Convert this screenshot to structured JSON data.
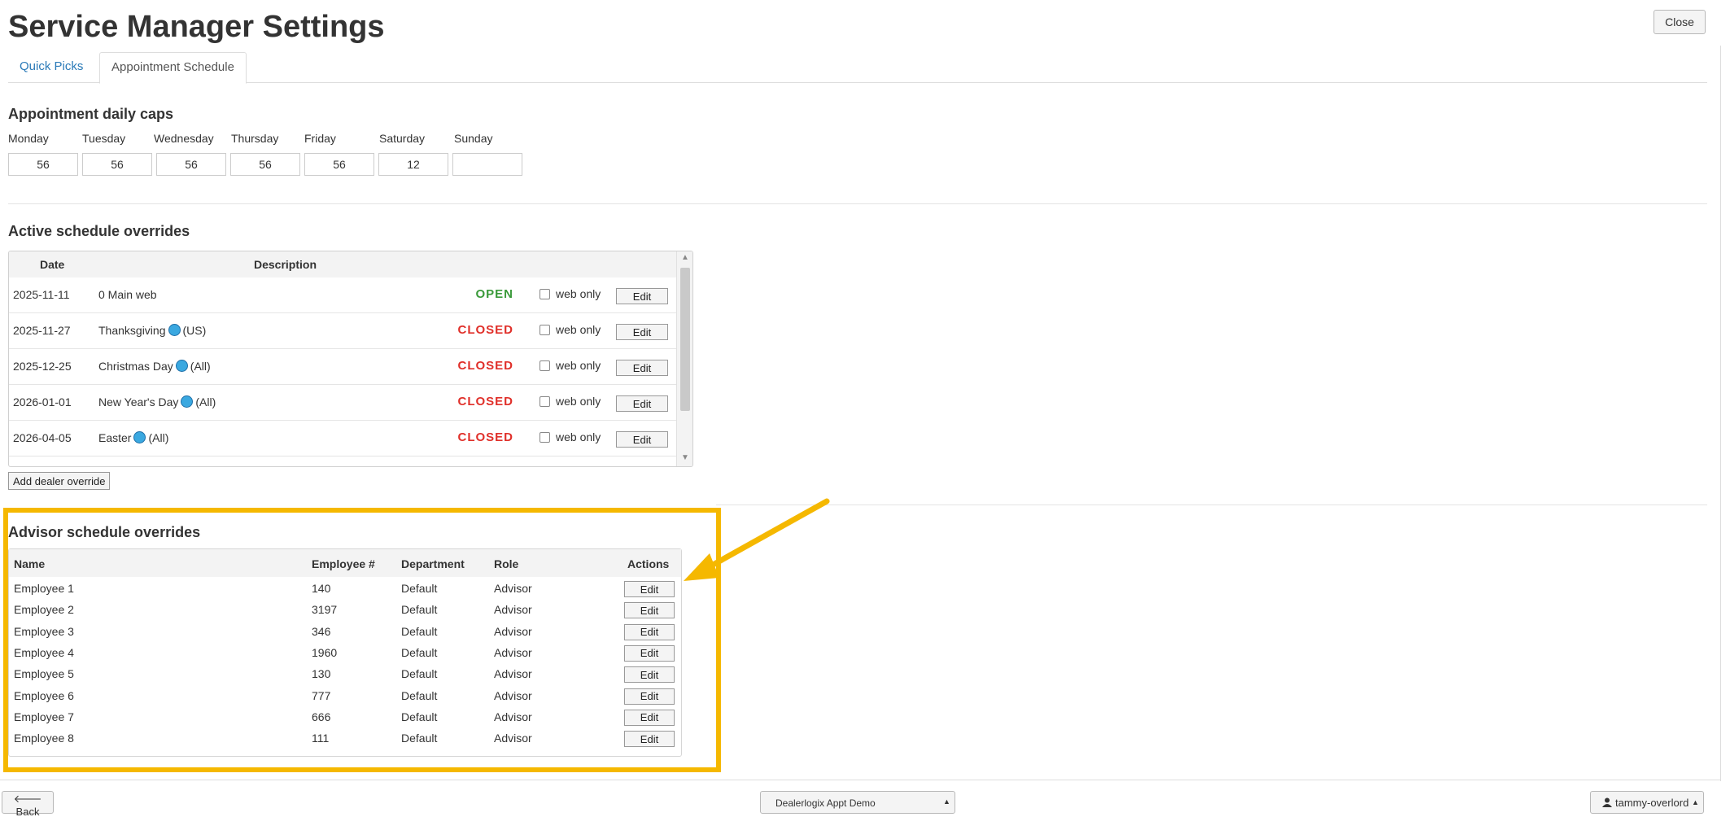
{
  "header": {
    "title": "Service Manager Settings",
    "close_label": "Close"
  },
  "tabs": [
    {
      "label": "Quick Picks",
      "active": false
    },
    {
      "label": "Appointment Schedule",
      "active": true
    }
  ],
  "daily_caps": {
    "title": "Appointment daily caps",
    "days": [
      {
        "label": "Monday",
        "value": "56"
      },
      {
        "label": "Tuesday",
        "value": "56"
      },
      {
        "label": "Wednesday",
        "value": "56"
      },
      {
        "label": "Thursday",
        "value": "56"
      },
      {
        "label": "Friday",
        "value": "56"
      },
      {
        "label": "Saturday",
        "value": "12"
      },
      {
        "label": "Sunday",
        "value": ""
      }
    ]
  },
  "active_overrides": {
    "title": "Active schedule overrides",
    "columns": [
      "Date",
      "Description"
    ],
    "web_only_label": "web only",
    "edit_label": "Edit",
    "rows": [
      {
        "date": "2025-11-11",
        "name": "0 Main web",
        "scope": "",
        "globe": false,
        "status": "OPEN",
        "status_color": "#3a9a3a",
        "web_only": false
      },
      {
        "date": "2025-11-27",
        "name": "Thanksgiving",
        "scope": "(US)",
        "globe": true,
        "status": "CLOSED",
        "status_color": "#e0302a",
        "web_only": false
      },
      {
        "date": "2025-12-25",
        "name": "Christmas Day",
        "scope": "(All)",
        "globe": true,
        "status": "CLOSED",
        "status_color": "#e0302a",
        "web_only": false
      },
      {
        "date": "2026-01-01",
        "name": "New Year's Day",
        "scope": "(All)",
        "globe": true,
        "status": "CLOSED",
        "status_color": "#e0302a",
        "web_only": false
      },
      {
        "date": "2026-04-05",
        "name": "Easter",
        "scope": "(All)",
        "globe": true,
        "status": "CLOSED",
        "status_color": "#e0302a",
        "web_only": false
      }
    ],
    "add_button_label": "Add dealer override"
  },
  "advisor_overrides": {
    "title": "Advisor schedule overrides",
    "columns": [
      "Name",
      "Employee #",
      "Department",
      "Role",
      "Actions"
    ],
    "edit_label": "Edit",
    "rows": [
      {
        "name": "Employee 1",
        "employee_no": "140",
        "department": "Default",
        "role": "Advisor"
      },
      {
        "name": "Employee 2",
        "employee_no": "3197",
        "department": "Default",
        "role": "Advisor"
      },
      {
        "name": "Employee 3",
        "employee_no": "346",
        "department": "Default",
        "role": "Advisor"
      },
      {
        "name": "Employee 4",
        "employee_no": "1960",
        "department": "Default",
        "role": "Advisor"
      },
      {
        "name": "Employee 5",
        "employee_no": "130",
        "department": "Default",
        "role": "Advisor"
      },
      {
        "name": "Employee 6",
        "employee_no": "777",
        "department": "Default",
        "role": "Advisor"
      },
      {
        "name": "Employee 7",
        "employee_no": "666",
        "department": "Default",
        "role": "Advisor"
      },
      {
        "name": "Employee 8",
        "employee_no": "111",
        "department": "Default",
        "role": "Advisor"
      }
    ],
    "highlight_color": "#f5b800"
  },
  "footer": {
    "back_label": "Back",
    "dealer_label": "Dealerlogix Appt Demo",
    "user_label": "tammy-overlord"
  }
}
